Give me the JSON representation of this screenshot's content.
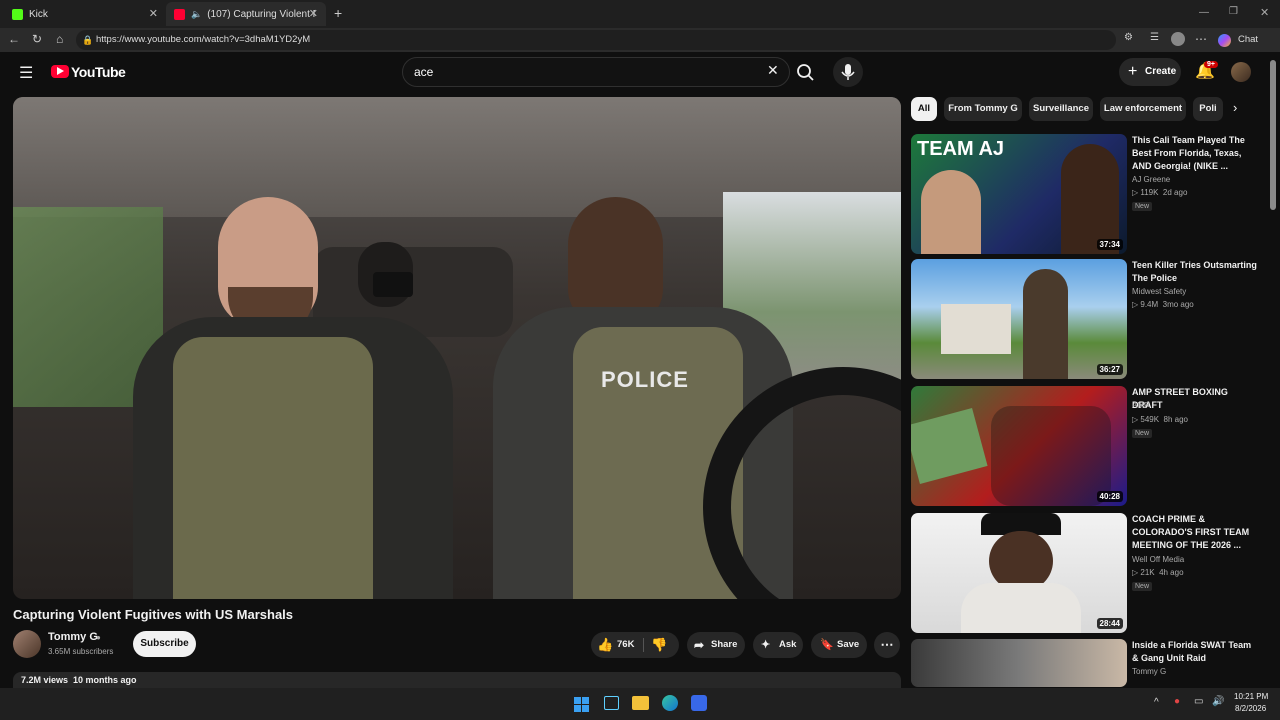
{
  "browser": {
    "tabs": [
      {
        "label": "Kick",
        "active": false
      },
      {
        "label": "(107) Capturing Violent Fugiti",
        "active": true
      }
    ],
    "url": "https://www.youtube.com/watch?v=3dhaM1YD2yM",
    "chat_label": "Chat"
  },
  "youtube": {
    "logo_text": "YouTube",
    "search_value": "ace",
    "create_label": "Create",
    "notification_badge": "9+"
  },
  "video": {
    "title": "Capturing Violent Fugitives with US Marshals",
    "channel": "Tommy G",
    "subscribers": "3.65M subscribers",
    "subscribe_label": "Subscribe",
    "likes": "76K",
    "share_label": "Share",
    "ask_label": "Ask",
    "save_label": "Save",
    "views": "7.2M views",
    "posted": "10 months ago",
    "overlay_text": "POLICE"
  },
  "chips": [
    "All",
    "From Tommy G",
    "Surveillance",
    "Law enforcement",
    "Poli"
  ],
  "related": [
    {
      "title": "This Cali Team Played The Best From Florida, Texas, AND Georgia! (NIKE ...",
      "channel": "AJ Greene",
      "views": "119K",
      "age": "2d ago",
      "new": "New",
      "duration": "37:34",
      "thumb_text": "TEAM AJ"
    },
    {
      "title": "Teen Killer Tries Outsmarting The Police",
      "channel": "Midwest Safety",
      "views": "9.4M",
      "age": "3mo ago",
      "new": "",
      "duration": "36:27",
      "thumb_text": ""
    },
    {
      "title": "AMP STREET BOXING DRAFT",
      "channel": "AMP",
      "views": "549K",
      "age": "8h ago",
      "new": "New",
      "duration": "40:28",
      "thumb_text": ""
    },
    {
      "title": "COACH PRIME & COLORADO'S FIRST TEAM MEETING OF THE 2026 ...",
      "channel": "Well Off Media",
      "views": "21K",
      "age": "4h ago",
      "new": "New",
      "duration": "28:44",
      "thumb_text": ""
    },
    {
      "title": "Inside a Florida SWAT Team & Gang Unit Raid",
      "channel": "Tommy G",
      "views": "",
      "age": "",
      "new": "",
      "duration": "",
      "thumb_text": ""
    }
  ],
  "taskbar": {
    "time": "10:21 PM",
    "date": "8/2/2026"
  }
}
